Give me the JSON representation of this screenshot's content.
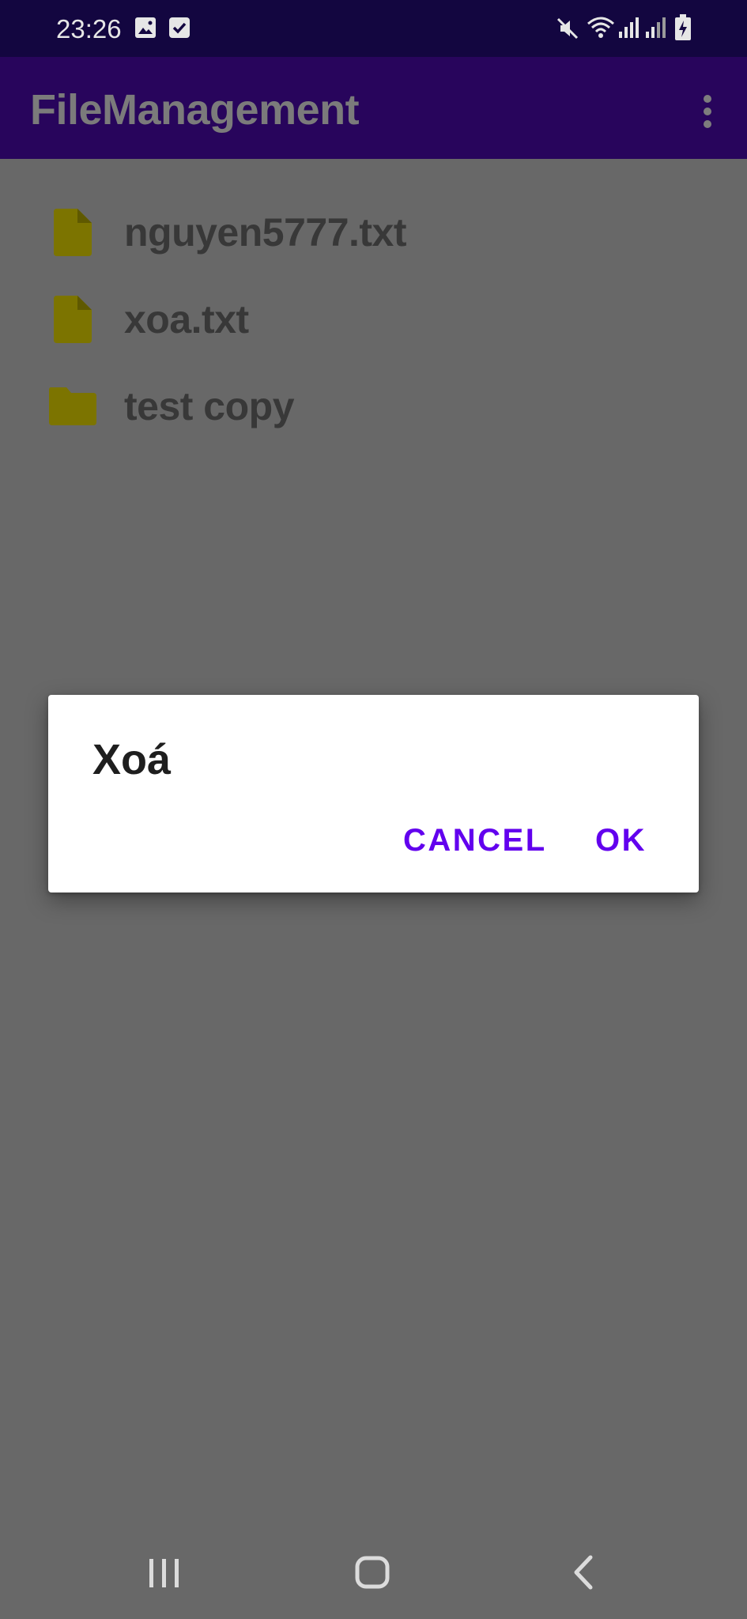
{
  "status_bar": {
    "time": "23:26",
    "icons": [
      "image-icon",
      "checkbox-icon",
      "mute-icon",
      "wifi-icon",
      "signal-icon",
      "signal-icon",
      "battery-charging-icon"
    ]
  },
  "app_bar": {
    "title": "FileManagement",
    "overflow_icon": "more-vert-icon"
  },
  "files": [
    {
      "name": "nguyen5777.txt",
      "type": "file",
      "icon": "file-icon"
    },
    {
      "name": "xoa.txt",
      "type": "file",
      "icon": "file-icon"
    },
    {
      "name": "test copy",
      "type": "folder",
      "icon": "folder-icon"
    }
  ],
  "dialog": {
    "title": "Xoá",
    "cancel_label": "CANCEL",
    "ok_label": "OK"
  },
  "nav_bar": {
    "icons": [
      "recent-apps-icon",
      "home-icon",
      "back-icon"
    ]
  },
  "colors": {
    "status_bar_bg": "#130640",
    "app_bar_bg": "#28055c",
    "scrim_bg": "#686868",
    "icon_tint": "#7c7400",
    "accent": "#6200ee",
    "dialog_bg": "#ffffff"
  }
}
